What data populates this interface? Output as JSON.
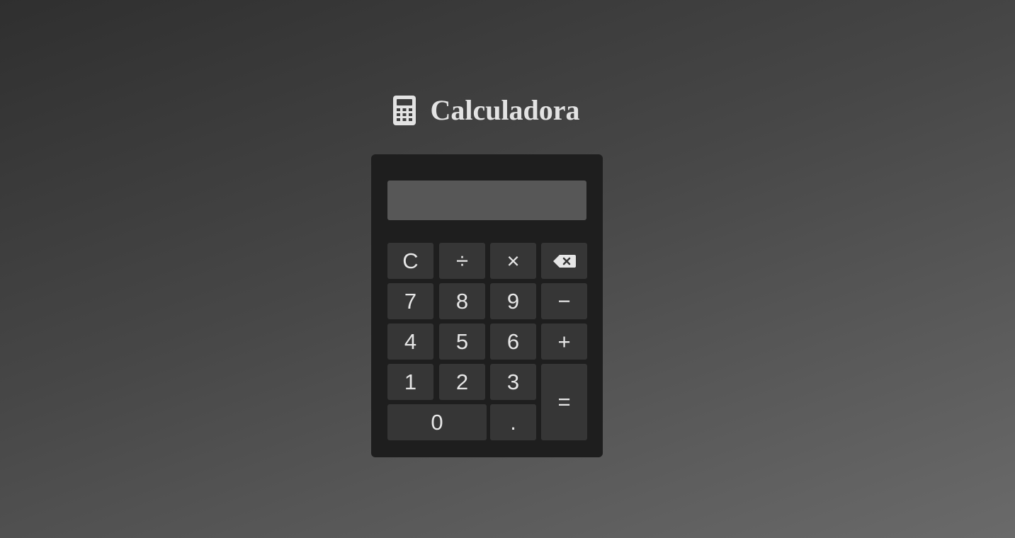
{
  "header": {
    "title": "Calculadora",
    "icon": "calculator-icon"
  },
  "display": {
    "value": ""
  },
  "keys": {
    "clear": "C",
    "divide": "÷",
    "multiply": "×",
    "backspace_icon": "backspace-icon",
    "seven": "7",
    "eight": "8",
    "nine": "9",
    "subtract": "−",
    "four": "4",
    "five": "5",
    "six": "6",
    "add": "+",
    "one": "1",
    "two": "2",
    "three": "3",
    "equals": "=",
    "zero": "0",
    "decimal": "."
  },
  "colors": {
    "calculator_body": "#1e1e1e",
    "display_background": "#575757",
    "key_background": "#363636",
    "text": "#e6e6e6"
  }
}
